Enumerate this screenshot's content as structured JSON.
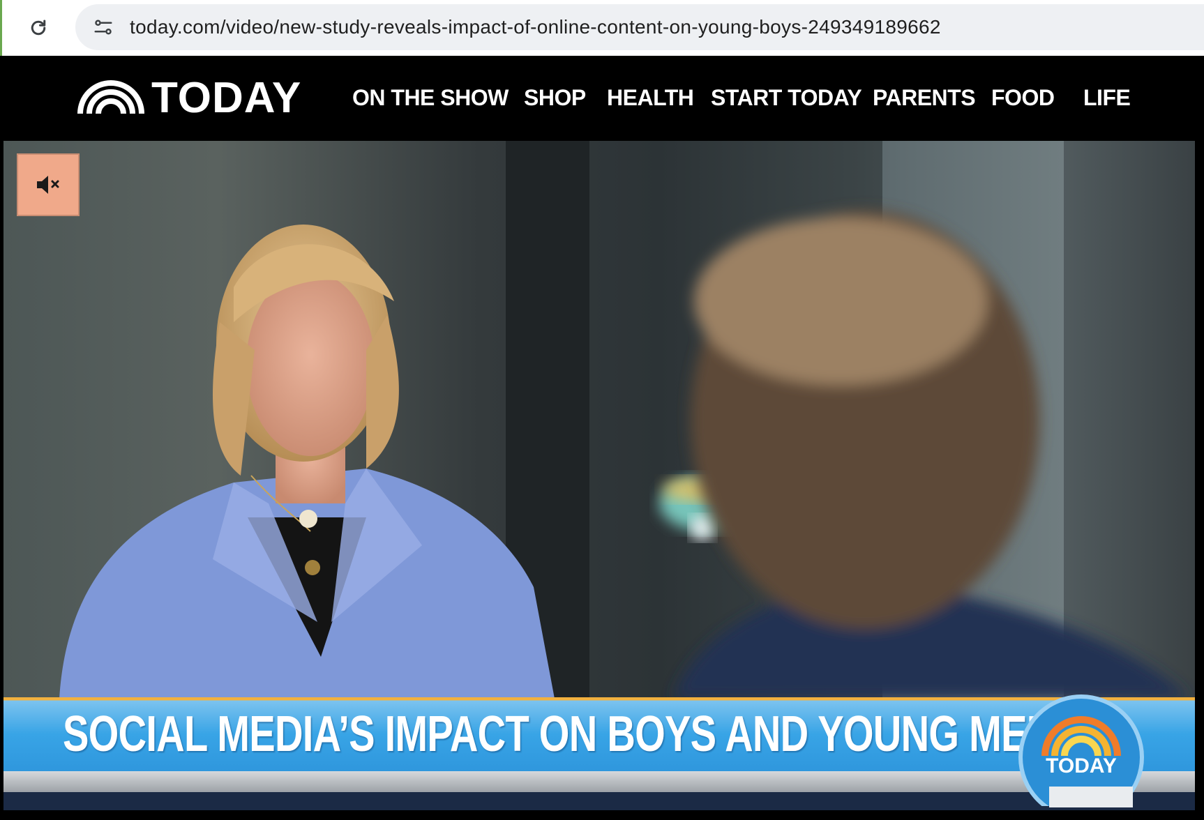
{
  "browser": {
    "url": "today.com/video/new-study-reveals-impact-of-online-content-on-young-boys-249349189662",
    "reload_icon": "reload-icon",
    "site_info_icon": "tune-icon"
  },
  "site": {
    "logo_text": "TODAY",
    "nav": [
      "ON THE SHOW",
      "SHOP",
      "HEALTH",
      "START TODAY",
      "PARENTS",
      "FOOD",
      "LIFE"
    ]
  },
  "video": {
    "mute_icon": "muted-speaker-icon",
    "headline": "SOCIAL MEDIA’S IMPACT ON BOYS AND YOUNG MEN",
    "badge_text": "TODAY",
    "colors": {
      "mute_button": "#f0a98a",
      "lower_third": "#38a4e6",
      "accent": "#f2b13f"
    }
  }
}
